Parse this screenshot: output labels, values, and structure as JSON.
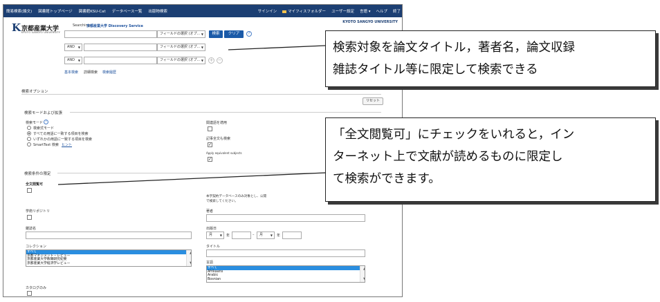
{
  "topnav": {
    "items": [
      "簡易検索(論文)",
      "図書館トップページ",
      "図書館KSU-Cat",
      "データベース一覧",
      "出版物検索"
    ],
    "right_items": [
      "サインイン",
      "マイフィスフォルダー",
      "ユーザー設定",
      "言語 ▾",
      "ヘルプ",
      "終了"
    ]
  },
  "logo": {
    "mark": "K",
    "name_jp": "京都産業大学",
    "name_en": "KYOTO SANGYO UNIVERSITY",
    "corner_text": "KYOTO SANGYO UNIVERSITY"
  },
  "search": {
    "searching_label": "Searching:",
    "service_name": "京都産業大学 Discovery Service",
    "field_select": "フィールドの選択 (オプ...",
    "search_button": "検索",
    "clear_button": "クリア",
    "help_glyph": "?",
    "bool_and": "AND",
    "add_row": "+",
    "remove_row": "−",
    "links": [
      "基本検索",
      "詳細検索",
      "検索履歴"
    ]
  },
  "options": {
    "title": "検索オプション",
    "reset_button": "リセット",
    "mode_section_title": "検索モードおよび拡張",
    "mode_label": "検索モード",
    "modes": [
      "検索式モード",
      "すべての用語に一致する項目を検索",
      "いずれかの用語に一致する項目を検索",
      "SmartText 検索"
    ],
    "modes_selected": 1,
    "smarttext_hint": "ヒント",
    "related_words_label": "関連語を適用",
    "fulltext_search_label": "記事全文も検索",
    "equivalent_subjects_label": "Apply equivalent subjects",
    "limit_section_title": "検索条件の限定",
    "fulltext_available_label": "全文閲覧可",
    "peer_note_1": "本学契約データベースのみ対象とし、公開",
    "peer_note_2": "で検索してください。",
    "repository_label": "学術リポジトリ",
    "author_label": "著者",
    "journal_label": "雑誌名",
    "pubdate_label": "出版日",
    "month_label": "月",
    "year_label": "年",
    "date_sep": "–",
    "collection_label": "コレクション",
    "collections": [
      "すべて",
      "京都マネジメント・レビュー",
      "京都産業大学教職研究紀要",
      "京都産業大学経済学レビュー"
    ],
    "title_label": "タイトル",
    "language_label": "言語",
    "languages": [
      "すべて",
      "Afrikaans",
      "Arabic",
      "Bosnian"
    ],
    "catalog_only_label": "カタログのみ"
  },
  "callouts": {
    "fields": [
      "検索対象を論文タイトル，著者名，論文収録",
      "雑誌タイトル等に限定して検索できる"
    ],
    "fulltext": [
      "「全文閲覧可」にチェックをいれると，イン",
      "ターネット上で文献が読めるものに限定し",
      "て検索ができます。"
    ]
  }
}
